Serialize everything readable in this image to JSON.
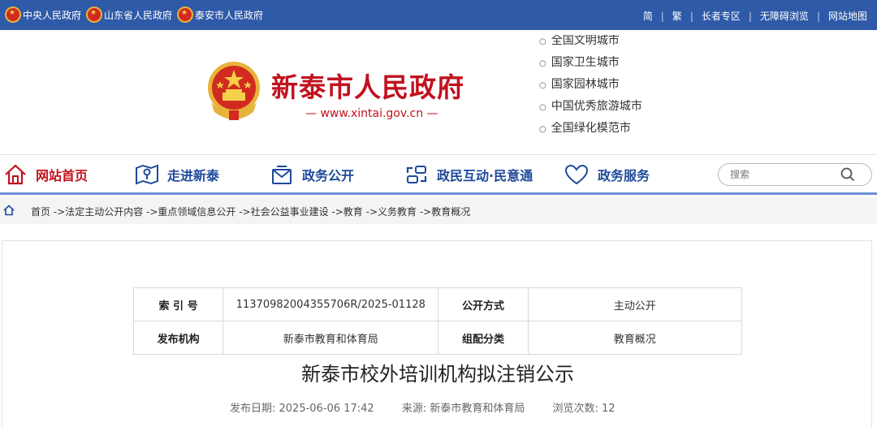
{
  "topbar": {
    "left_links": [
      "中央人民政府",
      "山东省人民政府",
      "泰安市人民政府"
    ],
    "right_links": [
      "简",
      "繁",
      "长者专区",
      "无障碍浏览",
      "网站地图"
    ]
  },
  "header": {
    "title": "新泰市人民政府",
    "url": "— www.xintai.gov.cn —",
    "honors": [
      "全国文明城市",
      "国家卫生城市",
      "国家园林城市",
      "中国优秀旅游城市",
      "全国绿化模范市"
    ]
  },
  "nav": {
    "items": [
      "网站首页",
      "走进新泰",
      "政务公开",
      "政民互动·民意通",
      "政务服务"
    ],
    "search_placeholder": "搜索"
  },
  "breadcrumb": {
    "path": "首页 ->法定主动公开内容 ->重点领域信息公开 ->社会公益事业建设 ->教育 ->义务教育 ->教育概况"
  },
  "meta": {
    "index_label": "索 引 号",
    "index_value": "11370982004355706R/2025-01128",
    "mode_label": "公开方式",
    "mode_value": "主动公开",
    "org_label": "发布机构",
    "org_value": "新泰市教育和体育局",
    "category_label": "组配分类",
    "category_value": "教育概况"
  },
  "article": {
    "title": "新泰市校外培训机构拟注销公示",
    "date": "发布日期: 2025-06-06 17:42",
    "source": "来源: 新泰市教育和体育局",
    "views": "浏览次数: 12"
  },
  "colors": {
    "topbar": "#2f5aa8",
    "brand_red": "#c1121f",
    "nav_blue": "#1e4a9a"
  }
}
